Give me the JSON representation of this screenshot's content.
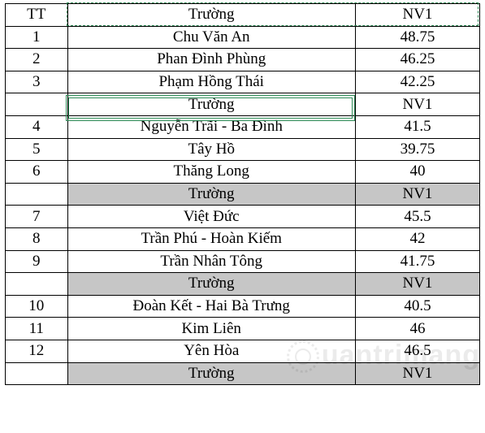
{
  "headers": {
    "tt": "TT",
    "truong": "Trường",
    "nv1": "NV1"
  },
  "sections": [
    {
      "rows": [
        {
          "tt": "1",
          "truong": "Chu Văn An",
          "nv1": "48.75"
        },
        {
          "tt": "2",
          "truong": "Phan Đình Phùng",
          "nv1": "46.25"
        },
        {
          "tt": "3",
          "truong": "Phạm Hồng Thái",
          "nv1": "42.25"
        }
      ],
      "repeat": {
        "truong": "Trường",
        "nv1": "NV1",
        "selected": true
      }
    },
    {
      "rows": [
        {
          "tt": "4",
          "truong": "Nguyễn Trãi - Ba Đình",
          "nv1": "41.5"
        },
        {
          "tt": "5",
          "truong": "Tây Hồ",
          "nv1": "39.75"
        },
        {
          "tt": "6",
          "truong": "Thăng Long",
          "nv1": "40"
        }
      ],
      "repeat": {
        "truong": "Trường",
        "nv1": "NV1",
        "gray": true
      }
    },
    {
      "rows": [
        {
          "tt": "7",
          "truong": "Việt Đức",
          "nv1": "45.5"
        },
        {
          "tt": "8",
          "truong": "Trần Phú - Hoàn Kiếm",
          "nv1": "42"
        },
        {
          "tt": "9",
          "truong": "Trần Nhân Tông",
          "nv1": "41.75"
        }
      ],
      "repeat": {
        "truong": "Trường",
        "nv1": "NV1",
        "gray": true
      }
    },
    {
      "rows": [
        {
          "tt": "10",
          "truong": "Đoàn Kết - Hai Bà Trưng",
          "nv1": "40.5"
        },
        {
          "tt": "11",
          "truong": "Kim Liên",
          "nv1": "46"
        },
        {
          "tt": "12",
          "truong": "Yên Hòa",
          "nv1": "46.5"
        }
      ],
      "repeat": {
        "truong": "Trường",
        "nv1": "NV1",
        "gray": true
      }
    }
  ],
  "watermark": "uantrimang"
}
